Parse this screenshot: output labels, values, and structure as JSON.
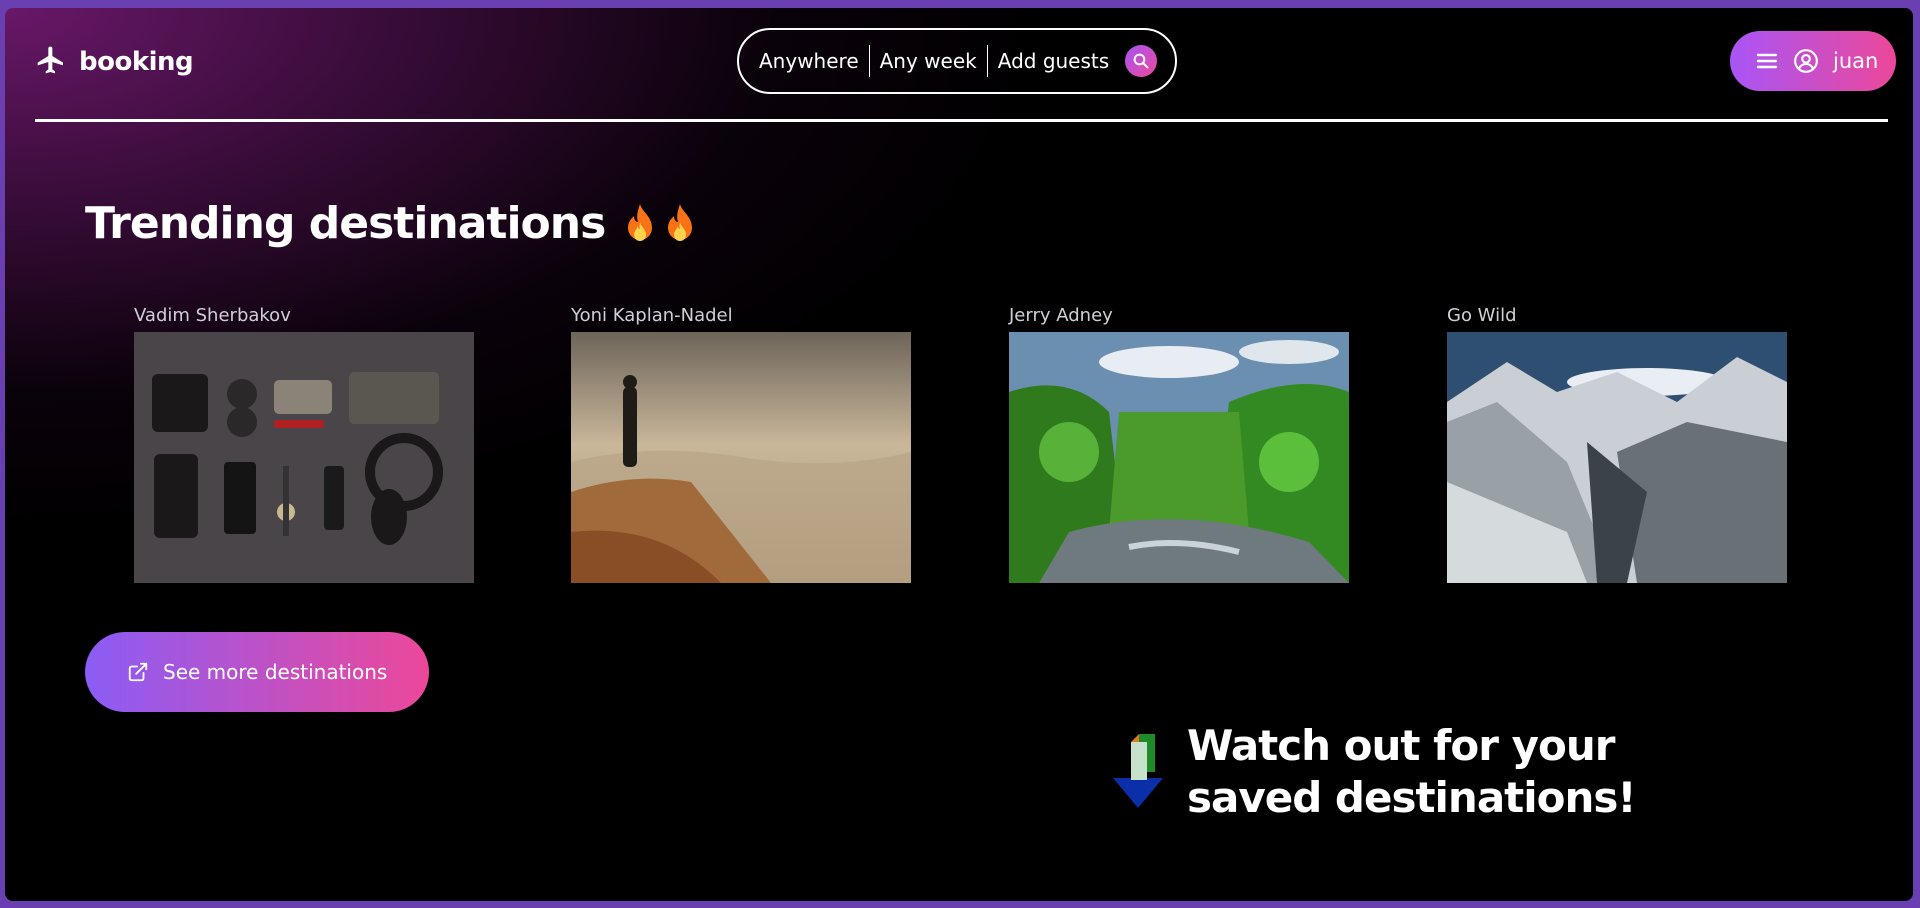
{
  "header": {
    "brand": "booking",
    "search": {
      "location": "Anywhere",
      "date": "Any week",
      "guests": "Add guests"
    },
    "user": {
      "name": "juan"
    }
  },
  "trending": {
    "title": "Trending destinations",
    "cards": [
      {
        "label": "Vadim Sherbakov"
      },
      {
        "label": "Yoni Kaplan-Nadel"
      },
      {
        "label": "Jerry Adney"
      },
      {
        "label": "Go Wild"
      }
    ]
  },
  "cta": {
    "label": "See more destinations"
  },
  "saved": {
    "text": "Watch out for your saved destinations!"
  },
  "colors": {
    "accent_start": "#a855f7",
    "accent_end": "#ec4899",
    "bg_glow": "#6e196e"
  }
}
